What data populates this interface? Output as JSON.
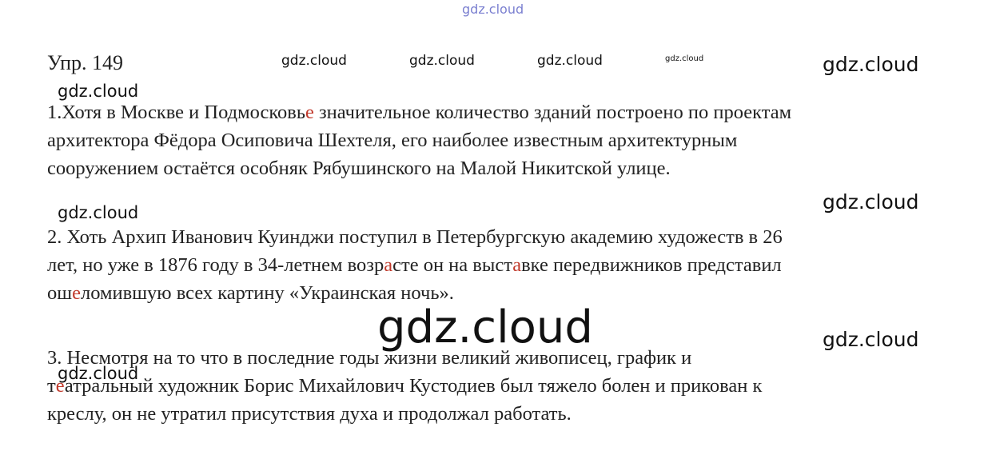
{
  "watermark": "gdz.cloud",
  "exercise_title": "Упр. 149",
  "colors": {
    "highlight": "#c0392b",
    "text": "#222222"
  },
  "paragraphs": [
    [
      [
        "1.Хотя в Москве и Подмосковь",
        "е",
        " значительное количество зданий построено по проектам"
      ],
      [
        "архитектора Фёдора Осиповича Шехтеля, его наиболее известным архитектурным"
      ],
      [
        "сооружением остаётся особняк Рябушинского на Малой Никитской улице."
      ]
    ],
    [
      [
        "2. Хоть Архип Иванович Куинджи поступил в Петербургскую академию художеств в 26"
      ],
      [
        "лет, но уже в 1876 году в 34-летнем возр",
        "а",
        "сте он на выст",
        "а",
        "вке передвижников представил"
      ],
      [
        "ош",
        "е",
        "ломившую всех картину «Украинская ночь»."
      ]
    ],
    [
      [
        "3. Несмотря на то что в последние годы жизни великий живописец, график и"
      ],
      [
        "т",
        "е",
        "атральный художник Борис Михайлович Кустодиев был тяжело болен и прикован к"
      ],
      [
        "креслу, он не утратил присутствия духа и продолжал работать."
      ]
    ]
  ]
}
